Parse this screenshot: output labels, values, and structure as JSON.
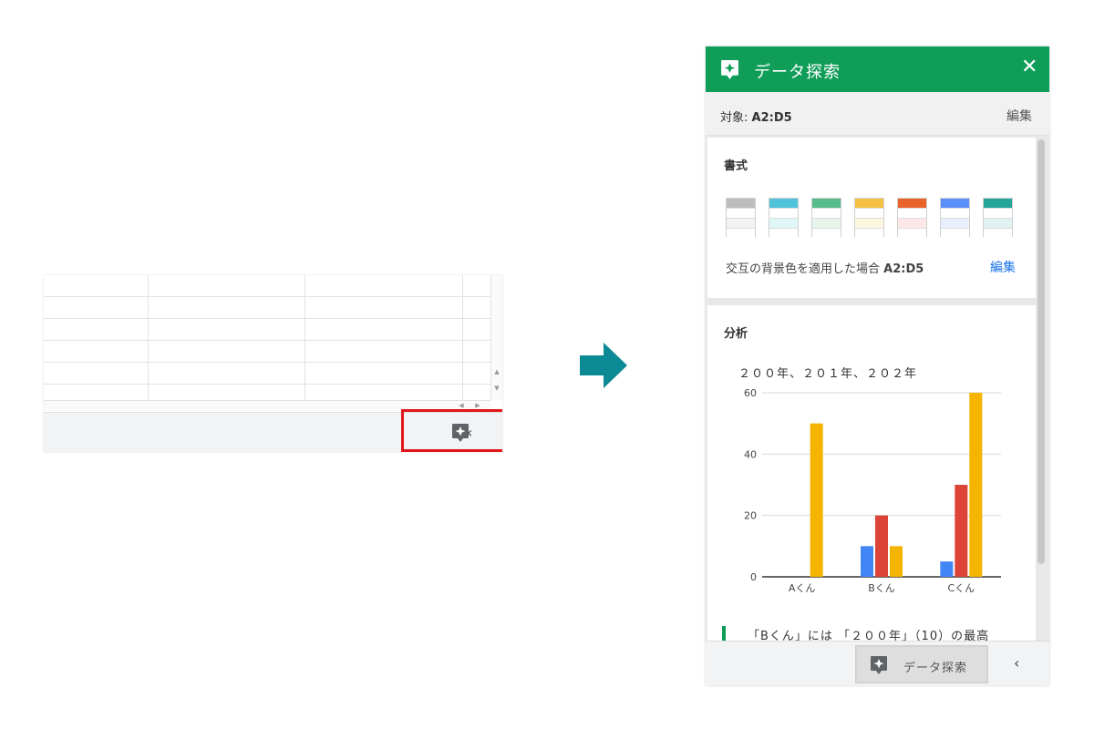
{
  "sheet": {
    "collapse_glyph": "‹",
    "explore_icon": "explore-sparkle-icon"
  },
  "panel": {
    "title": "データ探索",
    "close_glyph": "✕",
    "target_prefix": "対象: ",
    "target_range": "A2:D5",
    "target_edit": "編集",
    "format": {
      "title": "書式",
      "swatches": [
        {
          "name": "gray",
          "header": "#bdbdbd",
          "band": "#f3f3f3"
        },
        {
          "name": "cyan",
          "header": "#4fc3d9",
          "band": "#e0f7fa"
        },
        {
          "name": "green",
          "header": "#57bb8a",
          "band": "#e6f4ea"
        },
        {
          "name": "yellow",
          "header": "#f6c143",
          "band": "#fef7e0"
        },
        {
          "name": "orange",
          "header": "#e8622a",
          "band": "#fce8e6"
        },
        {
          "name": "blue",
          "header": "#5b8ff9",
          "band": "#e8f0fe"
        },
        {
          "name": "teal",
          "header": "#26a69a",
          "band": "#e0f2f1"
        }
      ],
      "description": "交互の背景色を適用した場合 ",
      "range": "A2:D5",
      "edit": "編集"
    },
    "analysis": {
      "title": "分析",
      "insight": "「Bくん」には 「２００年」（10）の最高"
    },
    "footer": {
      "explore_label": "データ探索",
      "collapse_glyph": "‹"
    },
    "colors": {
      "header_green": "#0f9d58",
      "link_blue": "#1a73e8",
      "highlight_red": "#e0161b",
      "arrow_teal": "#0b8a96"
    }
  },
  "chart_data": {
    "type": "bar",
    "title": "２００年、２０１年、２０２年",
    "categories": [
      "Aくん",
      "Bくん",
      "Cくん"
    ],
    "series": [
      {
        "color": "#4285f4",
        "values": [
          0,
          10,
          5
        ]
      },
      {
        "color": "#db4437",
        "values": [
          0,
          20,
          30
        ]
      },
      {
        "color": "#f4b400",
        "values": [
          50,
          10,
          60
        ]
      }
    ],
    "yticks": [
      0,
      20,
      40,
      60
    ],
    "ylim": [
      0,
      60
    ],
    "grid": true
  }
}
